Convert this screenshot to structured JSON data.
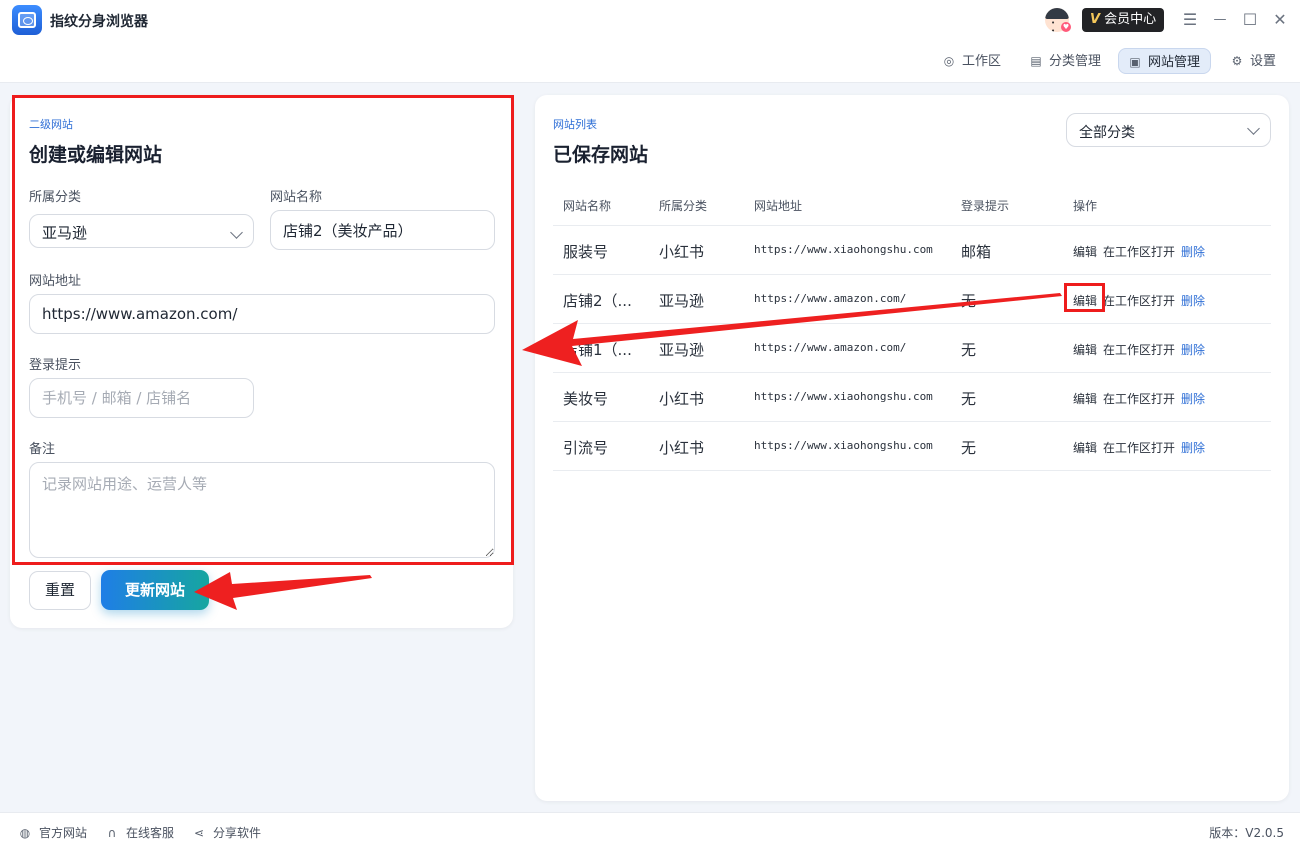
{
  "app": {
    "title": "指纹分身浏览器",
    "vip_label": "会员中心",
    "vip_v": "V"
  },
  "window_controls": {
    "menu": "☰",
    "minimize": "—",
    "maximize": "☐",
    "close": "✕"
  },
  "nav": {
    "items": [
      {
        "label": "工作区",
        "icon": "globe-icon"
      },
      {
        "label": "分类管理",
        "icon": "layout-icon"
      },
      {
        "label": "网站管理",
        "icon": "monitor-icon",
        "active": true
      },
      {
        "label": "设置",
        "icon": "settings-icon"
      }
    ]
  },
  "form": {
    "eyebrow": "二级网站",
    "title": "创建或编辑网站",
    "category_label": "所属分类",
    "category_value": "亚马逊",
    "name_label": "网站名称",
    "name_value": "店铺2（美妆产品）",
    "url_label": "网站地址",
    "url_value": "https://www.amazon.com/",
    "login_label": "登录提示",
    "login_placeholder": "手机号 / 邮箱 / 店铺名",
    "notes_label": "备注",
    "notes_placeholder": "记录网站用途、运营人等",
    "reset_label": "重置",
    "update_label": "更新网站"
  },
  "list": {
    "eyebrow": "网站列表",
    "title": "已保存网站",
    "filter_value": "全部分类",
    "columns": [
      "网站名称",
      "所属分类",
      "网站地址",
      "登录提示",
      "操作"
    ],
    "actions": {
      "edit": "编辑",
      "open": "在工作区打开",
      "delete": "删除"
    },
    "rows": [
      {
        "name": "服装号",
        "category": "小红书",
        "url": "https://www.xiaohongshu.com",
        "hint": "邮箱"
      },
      {
        "name": "店铺2（...",
        "category": "亚马逊",
        "url": "https://www.amazon.com/",
        "hint": "无"
      },
      {
        "name": "店铺1（...",
        "category": "亚马逊",
        "url": "https://www.amazon.com/",
        "hint": "无"
      },
      {
        "name": "美妆号",
        "category": "小红书",
        "url": "https://www.xiaohongshu.com",
        "hint": "无"
      },
      {
        "name": "引流号",
        "category": "小红书",
        "url": "https://www.xiaohongshu.com",
        "hint": "无"
      }
    ]
  },
  "footer": {
    "official_site": "官方网站",
    "support": "在线客服",
    "share": "分享软件",
    "version": "版本：V2.0.5"
  },
  "colors": {
    "accent": "#2f6fd6",
    "highlight": "#ee1c1c",
    "button_gradient_start": "#1f7ee6",
    "button_gradient_end": "#16a6a0"
  }
}
